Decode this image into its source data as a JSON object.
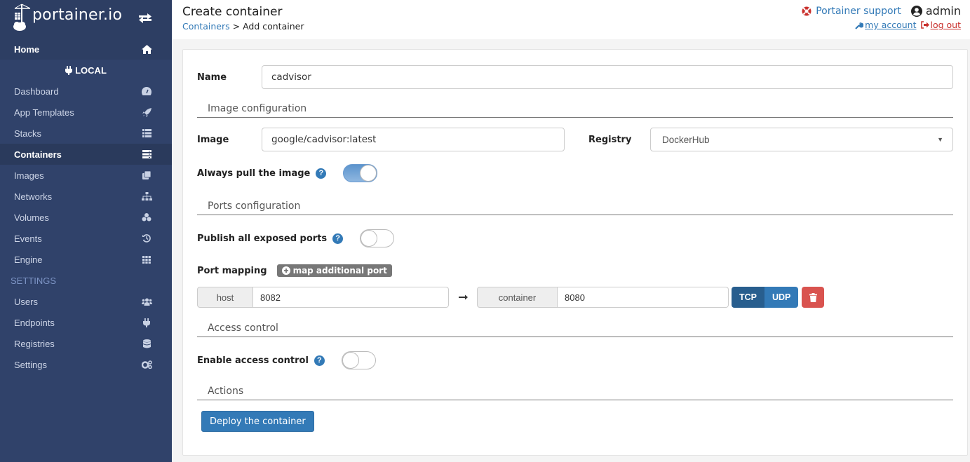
{
  "app": {
    "brand": "portainer.io"
  },
  "sidebar": {
    "home_label": "Home",
    "endpoint_label": "LOCAL",
    "items": [
      {
        "label": "Dashboard",
        "icon": "tachometer-icon"
      },
      {
        "label": "App Templates",
        "icon": "rocket-icon"
      },
      {
        "label": "Stacks",
        "icon": "list-icon"
      },
      {
        "label": "Containers",
        "icon": "server-icon",
        "active": true
      },
      {
        "label": "Images",
        "icon": "clone-icon"
      },
      {
        "label": "Networks",
        "icon": "sitemap-icon"
      },
      {
        "label": "Volumes",
        "icon": "cubes-icon"
      },
      {
        "label": "Events",
        "icon": "history-icon"
      },
      {
        "label": "Engine",
        "icon": "th-icon"
      }
    ],
    "settings_section_label": "SETTINGS",
    "settings_items": [
      {
        "label": "Users",
        "icon": "users-icon"
      },
      {
        "label": "Endpoints",
        "icon": "plug-icon"
      },
      {
        "label": "Registries",
        "icon": "database-icon"
      },
      {
        "label": "Settings",
        "icon": "cogs-icon"
      }
    ]
  },
  "header": {
    "title": "Create container",
    "breadcrumb_link": "Containers",
    "breadcrumb_separator": ">",
    "breadcrumb_current": "Add container",
    "support_label": "Portainer support",
    "username": "admin",
    "my_account_label": "my account",
    "log_out_label": "log out"
  },
  "form": {
    "name_label": "Name",
    "name_value": "cadvisor",
    "image_section": "Image configuration",
    "image_label": "Image",
    "image_value": "google/cadvisor:latest",
    "registry_label": "Registry",
    "registry_value": "DockerHub",
    "always_pull_label": "Always pull the image",
    "always_pull_enabled": true,
    "ports_section": "Ports configuration",
    "publish_all_label": "Publish all exposed ports",
    "publish_all_enabled": false,
    "port_mapping_label": "Port mapping",
    "map_additional_port_label": "map additional port",
    "port_mappings": [
      {
        "host_label": "host",
        "host_value": "8082",
        "container_label": "container",
        "container_value": "8080",
        "protocols": [
          "TCP",
          "UDP"
        ],
        "selected_protocol": "TCP"
      }
    ],
    "access_section": "Access control",
    "access_control_label": "Enable access control",
    "access_control_enabled": false,
    "actions_section": "Actions",
    "deploy_label": "Deploy the container"
  },
  "colors": {
    "sidebar_bg": "#30426a",
    "primary": "#337ab7",
    "danger": "#d9534f"
  }
}
